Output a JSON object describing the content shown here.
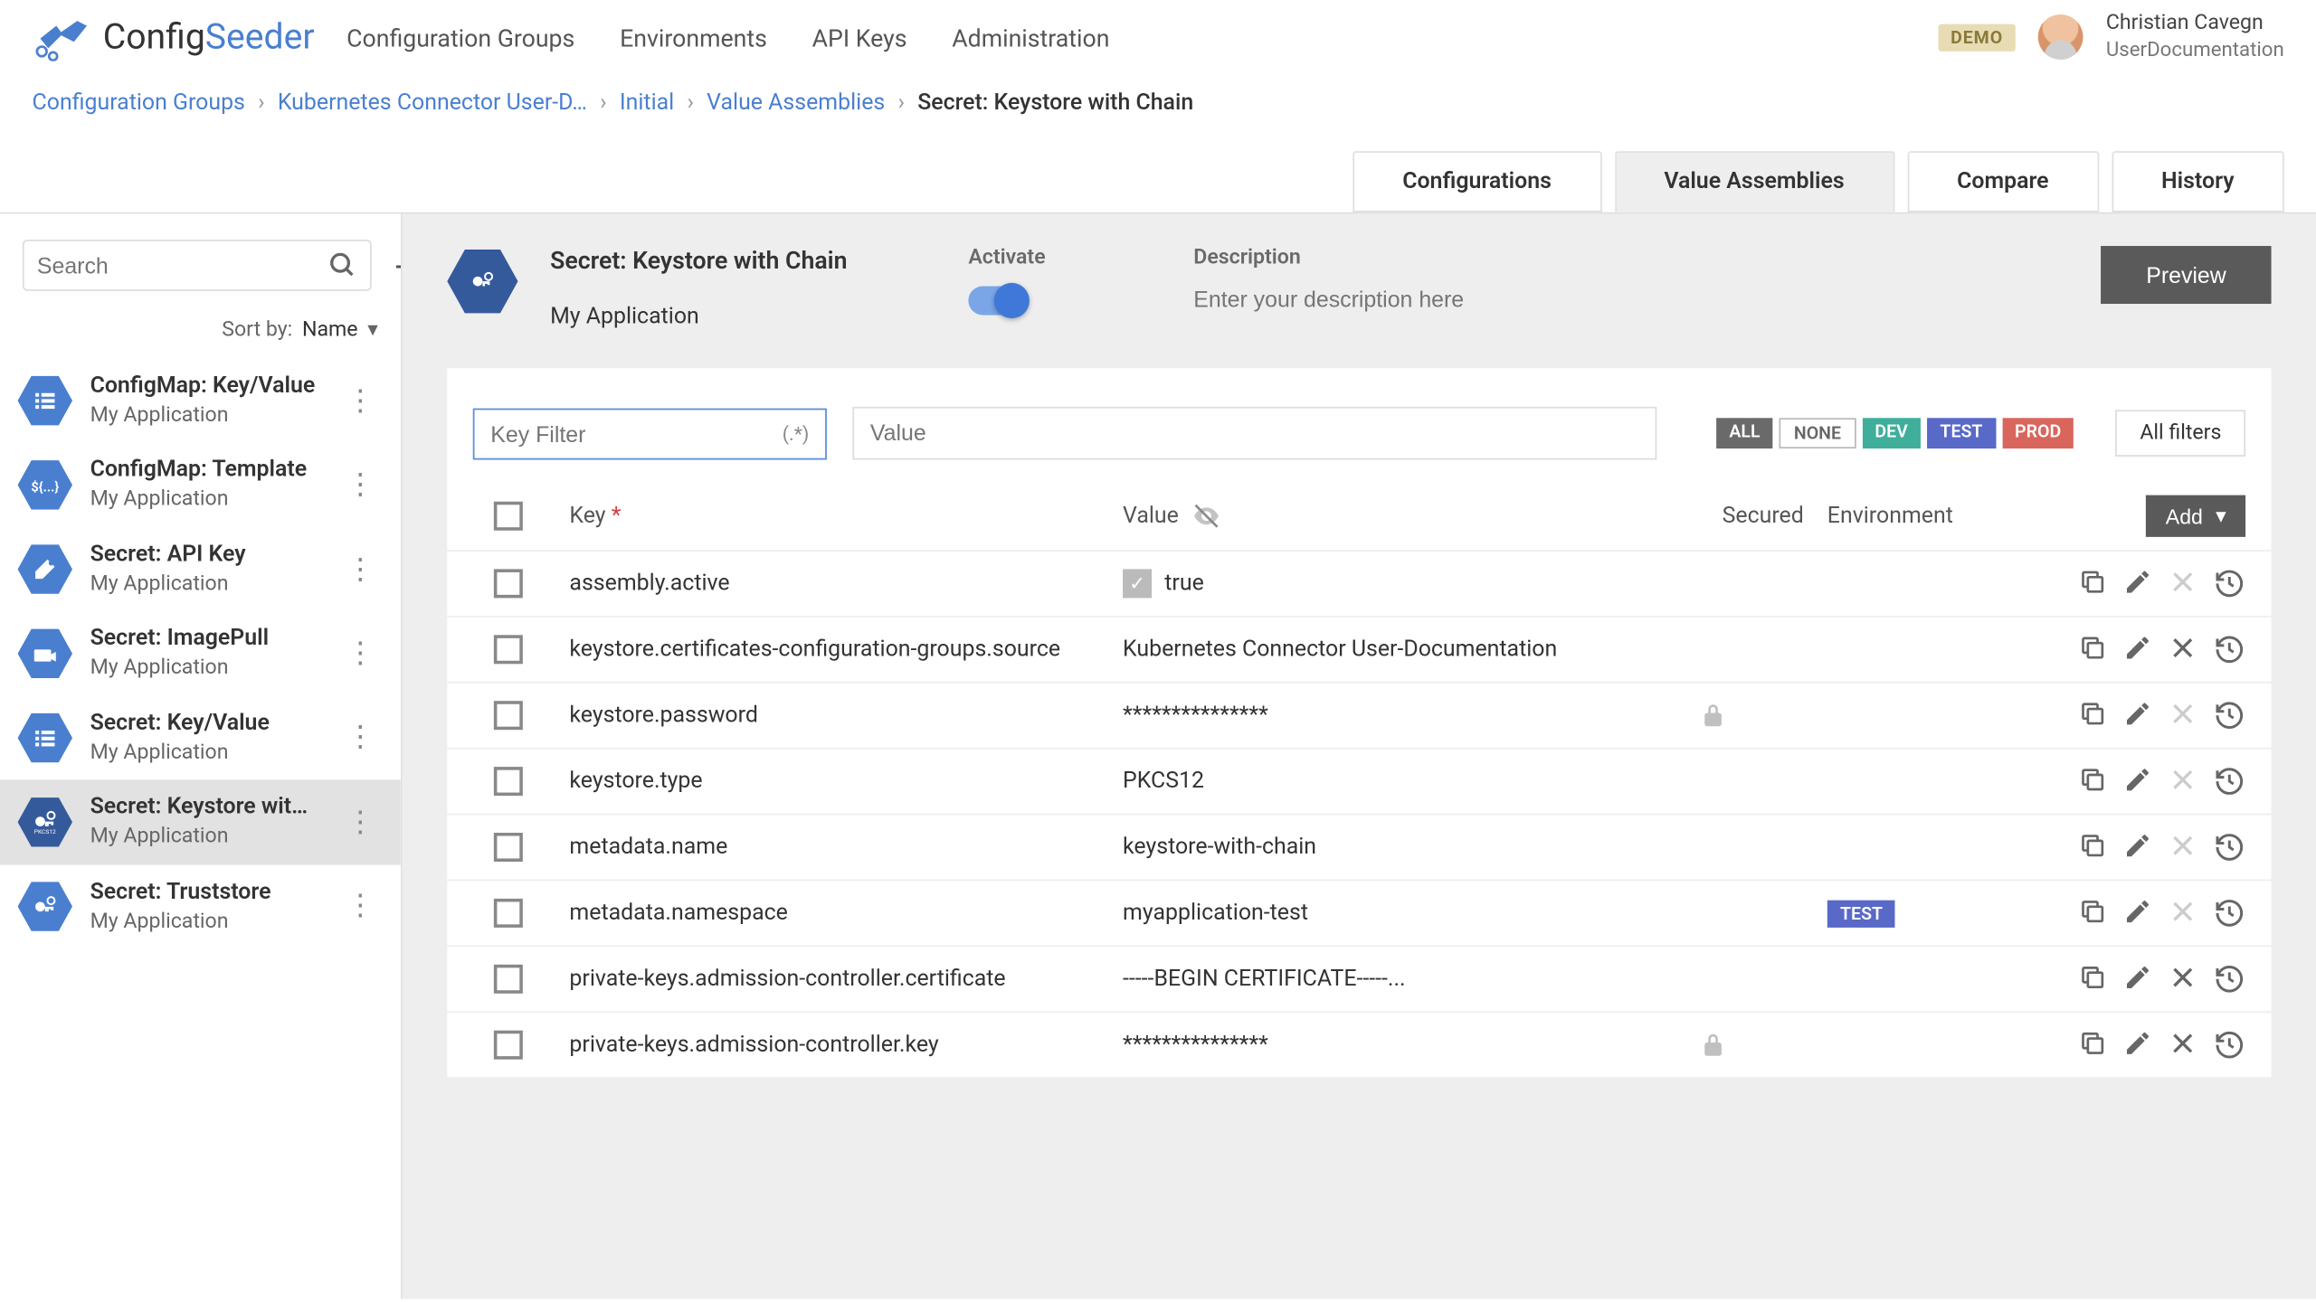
{
  "brand": {
    "part1": "Config",
    "part2": "Seeder"
  },
  "top_nav": [
    "Configuration Groups",
    "Environments",
    "API Keys",
    "Administration"
  ],
  "demo_badge": "DEMO",
  "user": {
    "name": "Christian Cavegn",
    "role": "UserDocumentation"
  },
  "breadcrumb": [
    {
      "label": "Configuration Groups",
      "link": true
    },
    {
      "label": "Kubernetes Connector User-D…",
      "link": true
    },
    {
      "label": "Initial",
      "link": true
    },
    {
      "label": "Value Assemblies",
      "link": true
    },
    {
      "label": "Secret: Keystore with Chain",
      "link": false
    }
  ],
  "tabs": [
    {
      "label": "Configurations",
      "active": false
    },
    {
      "label": "Value Assemblies",
      "active": true
    },
    {
      "label": "Compare",
      "active": false
    },
    {
      "label": "History",
      "active": false
    }
  ],
  "sidebar": {
    "search_placeholder": "Search",
    "sortby_label": "Sort by:",
    "sortby_value": "Name",
    "items": [
      {
        "title": "ConfigMap: Key/Value",
        "sub": "My Application",
        "icon": "list"
      },
      {
        "title": "ConfigMap: Template",
        "sub": "My Application",
        "icon": "template"
      },
      {
        "title": "Secret: API Key",
        "sub": "My Application",
        "icon": "apikey"
      },
      {
        "title": "Secret: ImagePull",
        "sub": "My Application",
        "icon": "imagepull"
      },
      {
        "title": "Secret: Key/Value",
        "sub": "My Application",
        "icon": "list"
      },
      {
        "title": "Secret: Keystore with …",
        "sub": "My Application",
        "icon": "keystore",
        "active": true
      },
      {
        "title": "Secret: Truststore",
        "sub": "My Application",
        "icon": "truststore"
      }
    ]
  },
  "header": {
    "title": "Secret: Keystore with Chain",
    "sub": "My Application",
    "activate_label": "Activate",
    "description_label": "Description",
    "description_placeholder": "Enter your description here",
    "preview": "Preview"
  },
  "filters": {
    "key_placeholder": "Key Filter",
    "regex_hint": "(.*)",
    "value_placeholder": "Value",
    "env_chips": [
      {
        "label": "ALL",
        "bg": "#6a6a6a"
      },
      {
        "label": "NONE",
        "outline": true
      },
      {
        "label": "DEV",
        "bg": "#3fae9a"
      },
      {
        "label": "TEST",
        "bg": "#5969c8"
      },
      {
        "label": "PROD",
        "bg": "#d9665d"
      }
    ],
    "all_filters": "All filters"
  },
  "columns": {
    "key": "Key",
    "value": "Value",
    "secured": "Secured",
    "env": "Environment",
    "add": "Add"
  },
  "rows": [
    {
      "key": "assembly.active",
      "value": "true",
      "value_check": true,
      "delete_enabled": false
    },
    {
      "key": "keystore.certificates-configuration-groups.source",
      "value": "Kubernetes Connector User-Documentation",
      "delete_enabled": true
    },
    {
      "key": "keystore.password",
      "value": "***************",
      "secured": true,
      "delete_enabled": false
    },
    {
      "key": "keystore.type",
      "value": "PKCS12",
      "delete_enabled": false
    },
    {
      "key": "metadata.name",
      "value": "keystore-with-chain",
      "delete_enabled": false
    },
    {
      "key": "metadata.namespace",
      "value": "myapplication-test",
      "env": "TEST",
      "delete_enabled": false
    },
    {
      "key": "private-keys.admission-controller.certificate",
      "value": "-----BEGIN CERTIFICATE-----...",
      "delete_enabled": true
    },
    {
      "key": "private-keys.admission-controller.key",
      "value": "***************",
      "secured": true,
      "delete_enabled": true
    }
  ]
}
